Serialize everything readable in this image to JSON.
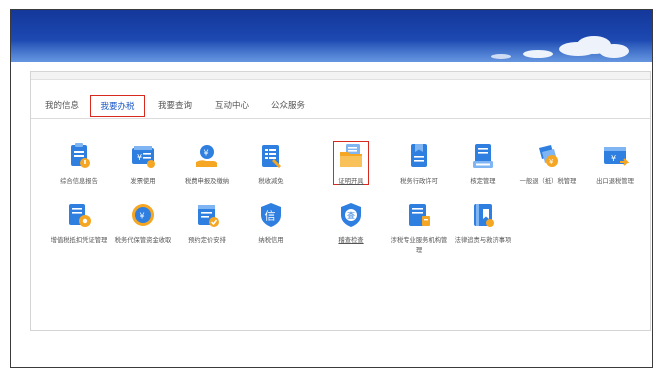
{
  "tabs": [
    {
      "label": "我的信息",
      "active": false
    },
    {
      "label": "我要办税",
      "active": true
    },
    {
      "label": "我要查询",
      "active": false
    },
    {
      "label": "互动中心",
      "active": false
    },
    {
      "label": "公众服务",
      "active": false
    }
  ],
  "services_row1": [
    {
      "label": "综合信息报告",
      "icon": "clipboard-info-icon"
    },
    {
      "label": "发票使用",
      "icon": "invoice-icon"
    },
    {
      "label": "税费申报及缴纳",
      "icon": "hand-coin-icon"
    },
    {
      "label": "税收减免",
      "icon": "tax-relief-list-icon"
    },
    {
      "label": "证明开具",
      "icon": "folder-document-icon"
    },
    {
      "label": "税务行政许可",
      "icon": "permit-document-icon"
    },
    {
      "label": "核定管理",
      "icon": "document-user-icon"
    },
    {
      "label": "一般退（抵）税管理",
      "icon": "coin-badge-icon"
    },
    {
      "label": "出口退税管理",
      "icon": "export-refund-icon"
    }
  ],
  "services_row2": [
    {
      "label": "增值税抵扣凭证管理",
      "icon": "document-gear-icon"
    },
    {
      "label": "税务代保管资金收取",
      "icon": "money-safe-icon"
    },
    {
      "label": "预约定价安排",
      "icon": "schedule-check-icon"
    },
    {
      "label": "纳税信用",
      "icon": "credit-shield-icon"
    },
    {
      "label": "稽查检查",
      "icon": "inspection-shield-icon"
    },
    {
      "label": "涉税专业服务机构管理",
      "icon": "agency-document-icon"
    },
    {
      "label": "法律追责与救济事项",
      "icon": "legal-book-icon"
    }
  ],
  "colors": {
    "banner": "#1c48b0",
    "accent_blue": "#2f7fe0",
    "accent_orange": "#f5a623",
    "selection_red": "#d9281e",
    "active_tab_text": "#1a56c6"
  },
  "selected_service": "证明开具"
}
